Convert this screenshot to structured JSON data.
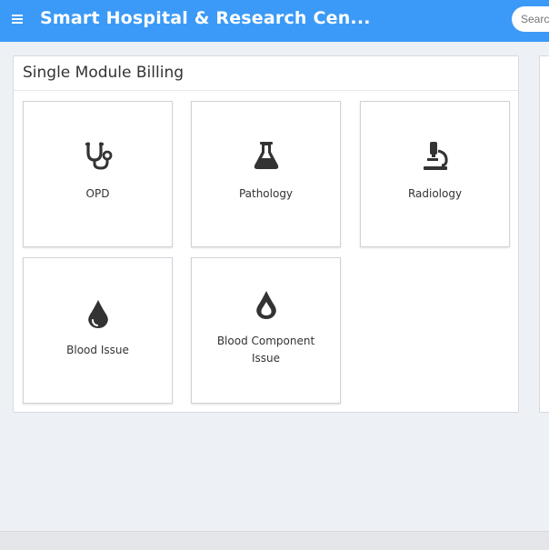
{
  "header": {
    "title": "Smart Hospital & Research Cen...",
    "search_placeholder": "Search"
  },
  "panel": {
    "title": "Single Module Billing"
  },
  "modules": [
    {
      "label": "OPD",
      "icon": "stethoscope-icon"
    },
    {
      "label": "Pathology",
      "icon": "flask-icon"
    },
    {
      "label": "Radiology",
      "icon": "microscope-icon"
    },
    {
      "label": "Blood Issue",
      "icon": "blood-drop-icon"
    },
    {
      "label": "Blood Component Issue",
      "icon": "blood-drop-outline-icon"
    }
  ],
  "colors": {
    "topbar": "#3b9af7",
    "icon": "#333333"
  }
}
